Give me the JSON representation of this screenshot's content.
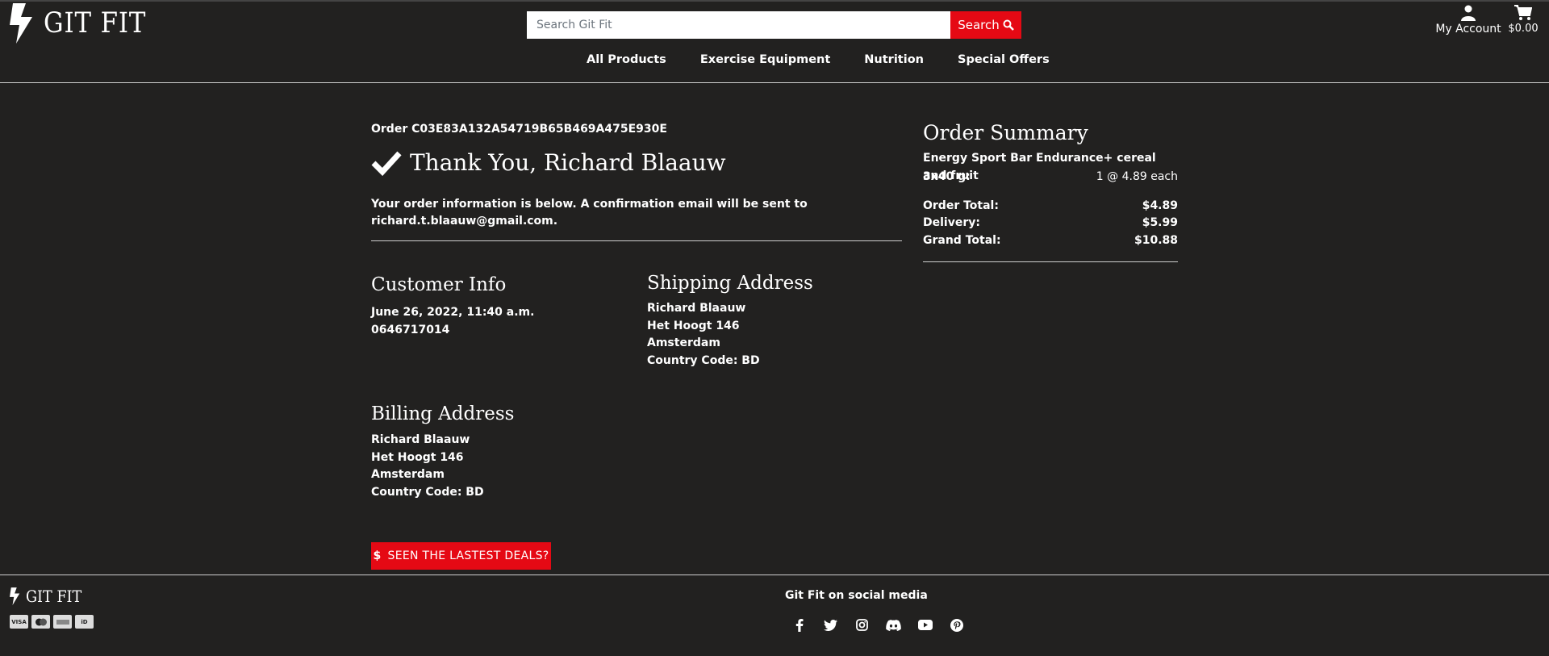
{
  "header": {
    "logo_text": "GIT FIT",
    "search_placeholder": "Search Git Fit",
    "search_button": "Search",
    "account_label": "My Account",
    "cart_total": "$0.00"
  },
  "nav": {
    "items": [
      "All Products",
      "Exercise Equipment",
      "Nutrition",
      "Special Offers"
    ]
  },
  "order": {
    "order_number": "Order C03E83A132A54719B65B469A475E930E",
    "thanks": "Thank You, Richard Blaauw",
    "info_line1": "Your order information is below. A confirmation email will be sent to",
    "email": "richard.t.blaauw@gmail.com",
    "email_suffix": "."
  },
  "customer_info": {
    "title": "Customer Info",
    "date": "June 26, 2022, 11:40 a.m.",
    "phone": "0646717014"
  },
  "shipping": {
    "title": "Shipping Address",
    "name": "Richard Blaauw",
    "street": "Het Hoogt 146",
    "city": "Amsterdam",
    "country": "Country Code: BD"
  },
  "billing": {
    "title": "Billing Address",
    "name": "Richard Blaauw",
    "street": "Het Hoogt 146",
    "city": "Amsterdam",
    "country": "Country Code: BD"
  },
  "deals_button": "SEEN THE LASTEST DEALS?",
  "summary": {
    "title": "Order Summary",
    "item_name": "Energy Sport Bar Endurance+ cereal and fruit",
    "item_size": "3x40 g:",
    "item_qty": "1 @ 4.89 each",
    "order_total_label": "Order Total:",
    "order_total": "$4.89",
    "delivery_label": "Delivery:",
    "delivery": "$5.99",
    "grand_total_label": "Grand Total:",
    "grand_total": "$10.88"
  },
  "footer": {
    "logo_text": "GIT FIT",
    "payment_icons": [
      "visa-icon",
      "mastercard-icon",
      "amex-icon",
      "ideal-icon"
    ],
    "social_title": "Git Fit on social media",
    "socials": [
      "facebook-icon",
      "twitter-icon",
      "instagram-icon",
      "discord-icon",
      "youtube-icon",
      "pinterest-icon"
    ]
  },
  "colors": {
    "background": "#222120",
    "accent": "#e50914",
    "text": "#ffffff"
  }
}
